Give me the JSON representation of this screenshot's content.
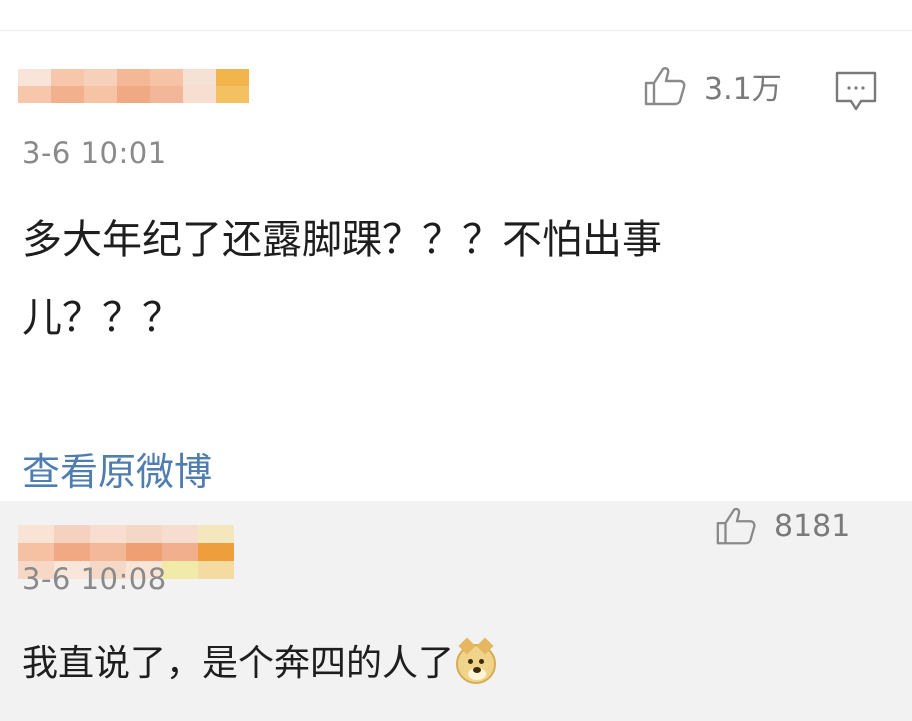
{
  "colors": {
    "accent_link": "#4f7db0",
    "text_primary": "#1e1e1e",
    "text_secondary": "#8a8a8a",
    "reply_background": "#f2f2f2"
  },
  "main_comment": {
    "username_visual": "pixelated-username",
    "time": "3-6 10:01",
    "like_icon": "thumbs-up-icon",
    "likes": "3.1万",
    "reply_icon": "comment-bubble-icon",
    "text_line1": "多大年纪了还露脚踝？？？不怕出事",
    "text_line2": "儿？？？",
    "view_original": "查看原微博"
  },
  "reply": {
    "username_visual": "pixelated-username",
    "time": "3-6 10:08",
    "like_icon": "thumbs-up-icon",
    "likes": "8181",
    "text": "我直说了，是个奔四的人了",
    "emoji": "doge-emoji-icon"
  }
}
